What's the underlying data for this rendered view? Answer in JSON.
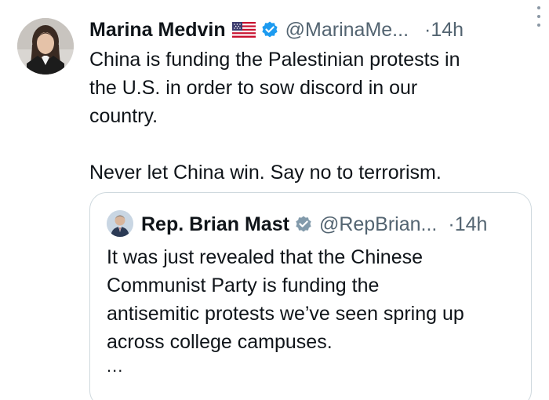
{
  "tweet": {
    "author": {
      "display_name": "Marina Medvin",
      "flag_icon": "us-flag-icon",
      "handle": "@MarinaMe...",
      "verified_color": "#1d9bf0"
    },
    "separator": "·",
    "time": "14h",
    "text_lines": [
      "China is funding the Palestinian protests in",
      "the U.S. in order to sow discord in our",
      "country."
    ],
    "text_second_paragraph": "Never let China win. Say no to terrorism."
  },
  "quoted_tweet": {
    "author": {
      "display_name": "Rep. Brian Mast",
      "handle": "@RepBrian...",
      "verified_color": "#829aab"
    },
    "separator": "·",
    "time": "14h",
    "text_lines": [
      "It was just revealed that the Chinese",
      "Communist Party is funding the",
      "antisemitic protests we’ve seen spring up",
      "across college campuses."
    ],
    "ellipsis": "..."
  }
}
